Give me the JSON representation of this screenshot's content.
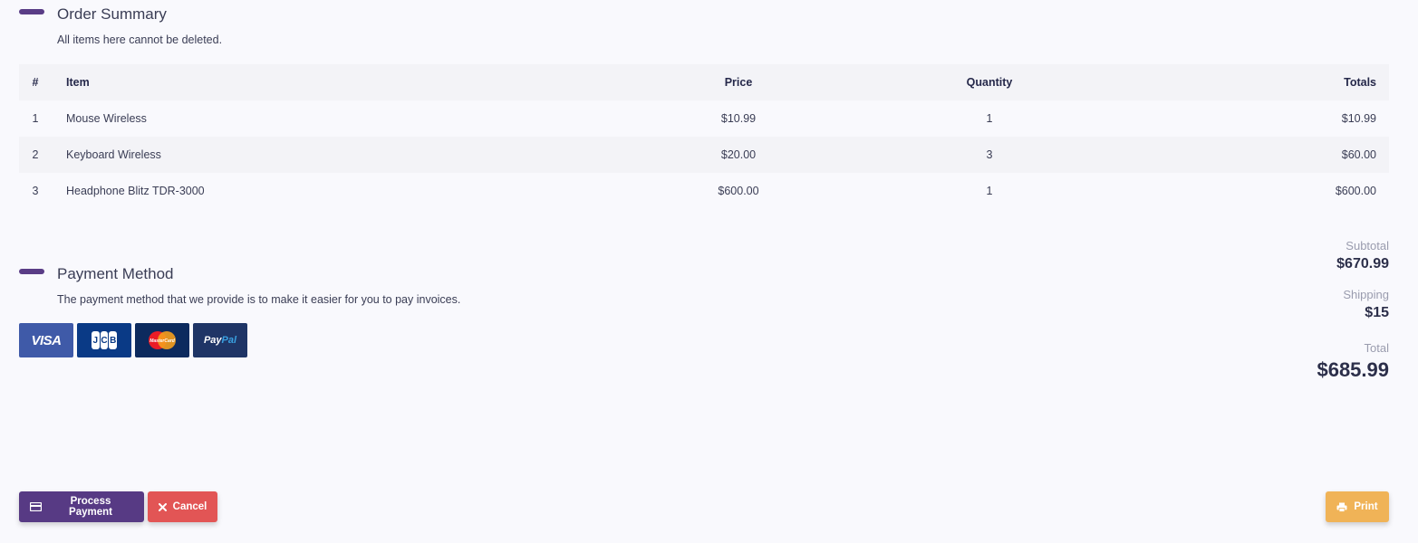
{
  "order_summary": {
    "title": "Order Summary",
    "description": "All items here cannot be deleted."
  },
  "table": {
    "headers": {
      "num": "#",
      "item": "Item",
      "price": "Price",
      "quantity": "Quantity",
      "totals": "Totals"
    },
    "rows": [
      {
        "num": "1",
        "item": "Mouse Wireless",
        "price": "$10.99",
        "quantity": "1",
        "total": "$10.99"
      },
      {
        "num": "2",
        "item": "Keyboard Wireless",
        "price": "$20.00",
        "quantity": "3",
        "total": "$60.00"
      },
      {
        "num": "3",
        "item": "Headphone Blitz TDR-3000",
        "price": "$600.00",
        "quantity": "1",
        "total": "$600.00"
      }
    ]
  },
  "payment_method": {
    "title": "Payment Method",
    "description": "The payment method that we provide is to make it easier for you to pay invoices.",
    "cards": [
      {
        "name": "visa-card-icon",
        "label": "VISA"
      },
      {
        "name": "jcb-card-icon",
        "label": "JCB"
      },
      {
        "name": "mastercard-card-icon",
        "label": "MasterCard"
      },
      {
        "name": "paypal-card-icon",
        "label": "PayPal"
      }
    ]
  },
  "summary": {
    "subtotal_label": "Subtotal",
    "subtotal_value": "$670.99",
    "shipping_label": "Shipping",
    "shipping_value": "$15",
    "total_label": "Total",
    "total_value": "$685.99"
  },
  "actions": {
    "process_label": "Process Payment",
    "cancel_label": "Cancel",
    "print_label": "Print"
  },
  "colors": {
    "accent": "#573a84",
    "cancel": "#e25555",
    "print": "#f0b357",
    "background": "#f9f9fd"
  }
}
